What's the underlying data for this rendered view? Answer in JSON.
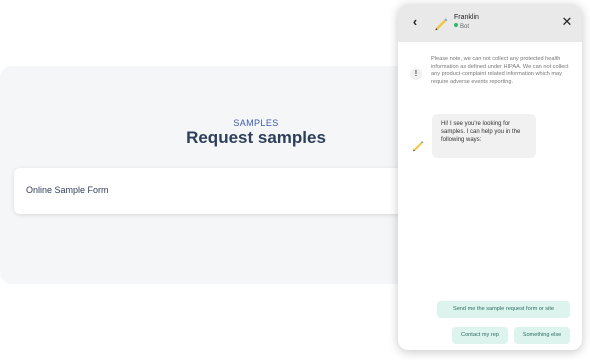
{
  "page": {
    "eyebrow": "SAMPLES",
    "title": "Request samples",
    "form_card_label": "Online Sample Form"
  },
  "chat": {
    "header": {
      "back_glyph": "‹",
      "bot_name": "Franklin",
      "bot_status": "Bot",
      "close_glyph": "✕",
      "avatar_icon": "pencil-icon",
      "status_color": "#2eb86a"
    },
    "notice": {
      "icon_glyph": "!",
      "text": "Please note, we can not collect any protected health information as defined under HIPAA. We can not collect any product-complaint related information which may require adverse events reporting."
    },
    "bot_message": {
      "text": "Hi! I see you're looking for samples. I can help you in the following ways:"
    },
    "quick_replies": [
      {
        "label": "Send me the sample request form or site"
      },
      {
        "label": "Contact my rep"
      },
      {
        "label": "Something else"
      }
    ]
  },
  "colors": {
    "accent": "#3c5aa6",
    "title": "#2f3f5a",
    "quick_reply_bg": "#ddf3ee",
    "quick_reply_text": "#2d6e61",
    "chat_header_bg": "#e9e9e9"
  }
}
